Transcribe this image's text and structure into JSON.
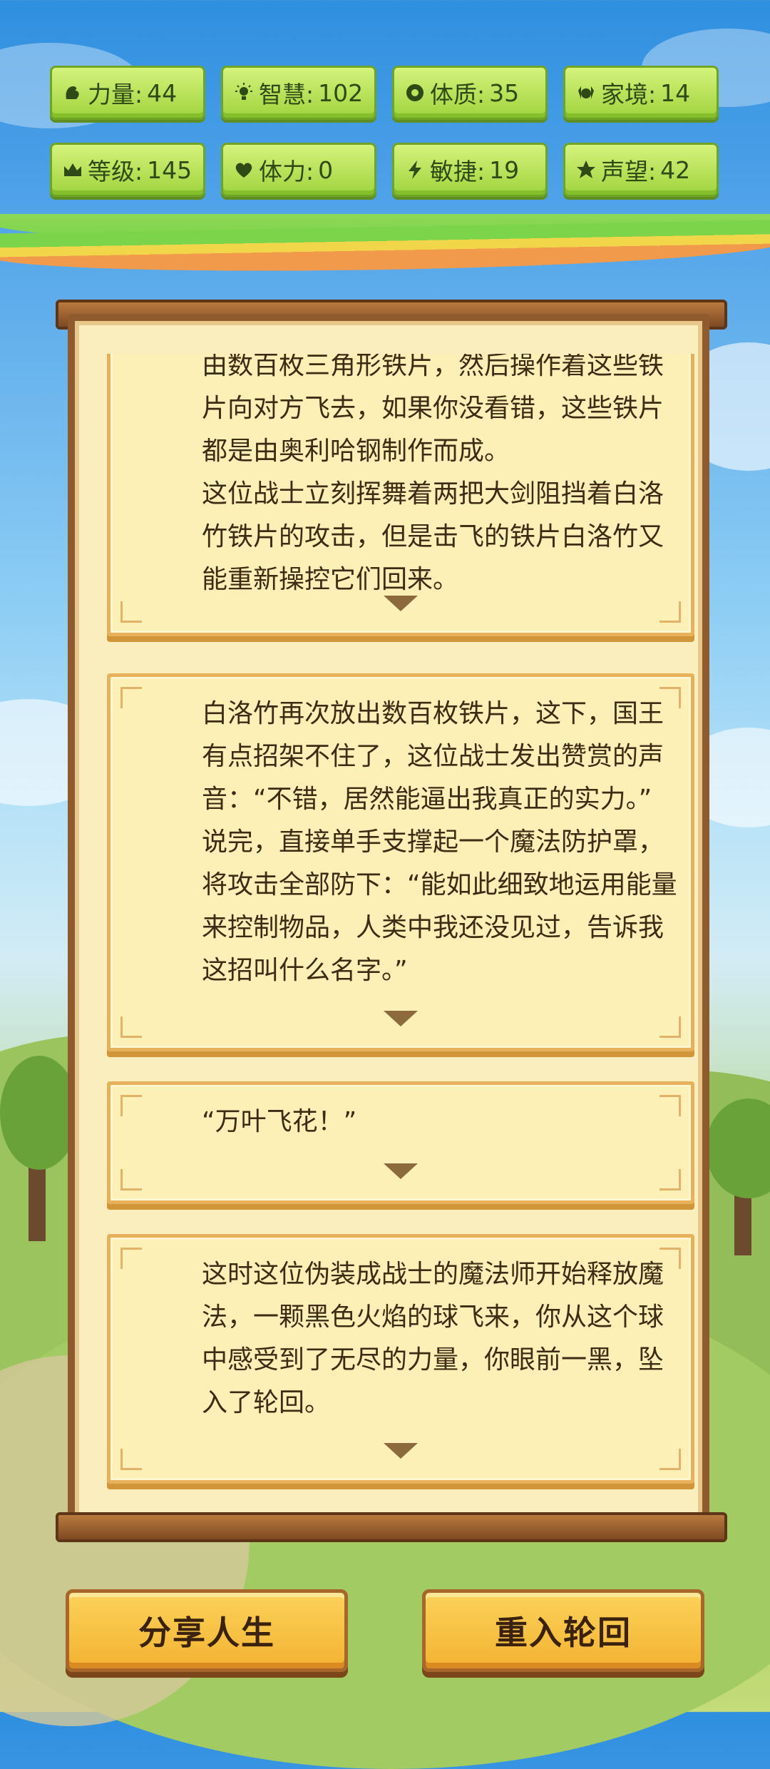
{
  "stats": [
    {
      "icon": "strength-icon",
      "label": "力量:",
      "value": "44"
    },
    {
      "icon": "wisdom-icon",
      "label": "智慧:",
      "value": "102"
    },
    {
      "icon": "constitution-icon",
      "label": "体质:",
      "value": "35"
    },
    {
      "icon": "family-icon",
      "label": "家境:",
      "value": "14"
    },
    {
      "icon": "crown-icon",
      "label": "等级:",
      "value": "145"
    },
    {
      "icon": "heart-icon",
      "label": "体力:",
      "value": " 0"
    },
    {
      "icon": "lightning-icon",
      "label": "敏捷:",
      "value": "19"
    },
    {
      "icon": "star-icon",
      "label": "声望:",
      "value": "42"
    }
  ],
  "story": [
    {
      "text": "由数百枚三角形铁片，然后操作着这些铁\n片向对方飞去，如果你没看错，这些铁片\n都是由奥利哈钢制作而成。\n这位战士立刻挥舞着两把大剑阻挡着白洛\n竹铁片的攻击，但是击飞的铁片白洛竹又\n能重新操控它们回来。"
    },
    {
      "text": "白洛竹再次放出数百枚铁片，这下，国王\n有点招架不住了，这位战士发出赞赏的声\n音：“不错，居然能逼出我真正的实力。”\n说完，直接单手支撑起一个魔法防护罩，\n将攻击全部防下：“能如此细致地运用能量\n来控制物品，人类中我还没见过，告诉我\n这招叫什么名字。”"
    },
    {
      "text": "“万叶飞花！”"
    },
    {
      "text": "这时这位伪装成战士的魔法师开始释放魔\n法，一颗黑色火焰的球飞来，你从这个球\n中感受到了无尽的力量，你眼前一黑，坠\n入了轮回。"
    }
  ],
  "buttons": {
    "share_label": "分享人生",
    "restart_label": "重入轮回"
  }
}
